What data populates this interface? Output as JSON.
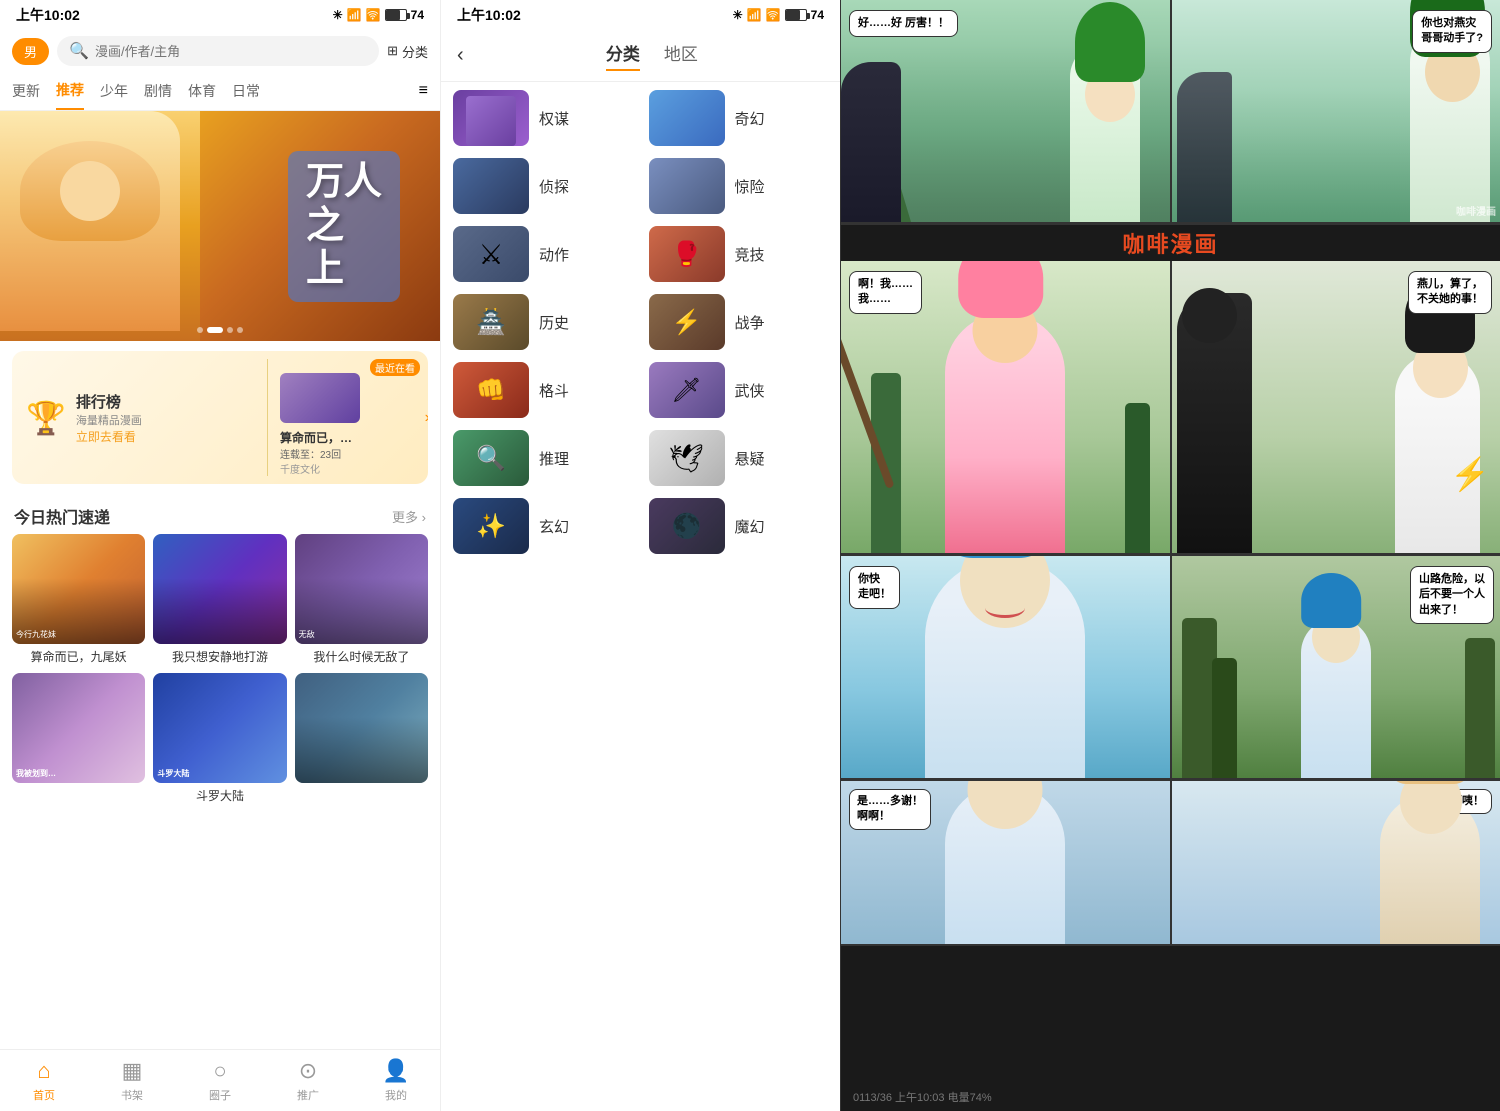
{
  "home": {
    "status_time": "上午10:02",
    "gender_btn": "男",
    "search_placeholder": "漫画/作者/主角",
    "category_btn": "分类",
    "nav_tabs": [
      "更新",
      "推荐",
      "少年",
      "剧情",
      "体育",
      "日常"
    ],
    "active_tab": "推荐",
    "banner_title": "万人\n之\n上",
    "ranking_title": "排行榜",
    "ranking_sub": "海量精品漫画",
    "ranking_link": "立即去看看",
    "recent_label": "最近在看",
    "recent_manga": "算命而已，…",
    "recent_chapter": "连载至：23回",
    "recent_publisher": "千度文化",
    "section_title": "今日热门速递",
    "more_btn": "更多 ›",
    "manga_list": [
      {
        "title": "算命而已，九尾妖"
      },
      {
        "title": "我只想安静地打游"
      },
      {
        "title": "我什么时候无敌了"
      }
    ],
    "manga_list2": [
      {
        "title": ""
      },
      {
        "title": "斗罗大陆"
      },
      {
        "title": ""
      }
    ],
    "bottom_nav": [
      {
        "label": "首页",
        "icon": "⌂",
        "active": true
      },
      {
        "label": "书架",
        "icon": "▦"
      },
      {
        "label": "圈子",
        "icon": "○"
      },
      {
        "label": "推广",
        "icon": "⊙"
      },
      {
        "label": "我的",
        "icon": "👤"
      }
    ]
  },
  "category": {
    "status_time": "上午10:02",
    "back_icon": "‹",
    "tabs": [
      {
        "label": "分类",
        "active": true
      },
      {
        "label": "地区",
        "active": false
      }
    ],
    "items": [
      {
        "label": "权谋",
        "color": "ct-purple"
      },
      {
        "label": "奇幻",
        "color": "ct-blue"
      },
      {
        "label": "侦探",
        "color": "ct-dark"
      },
      {
        "label": "惊险",
        "color": "ct-action"
      },
      {
        "label": "动作",
        "color": "ct-action"
      },
      {
        "label": "竞技",
        "color": "ct-fight"
      },
      {
        "label": "历史",
        "color": "ct-hist"
      },
      {
        "label": "战争",
        "color": "ct-war"
      },
      {
        "label": "格斗",
        "color": "ct-fight"
      },
      {
        "label": "武侠",
        "color": "ct-purple"
      },
      {
        "label": "推理",
        "color": "ct-reason"
      },
      {
        "label": "悬疑",
        "color": "ct-mystery"
      },
      {
        "label": "玄幻",
        "color": "ct-fantasy"
      },
      {
        "label": "魔幻",
        "color": "ct-magic"
      }
    ]
  },
  "reader": {
    "bubble1_top": "好……好\n厉害！！",
    "bubble1_right": "你也对燕灾\n哥哥动手了?",
    "bubble2_left": "啊！我……\n我……",
    "bubble2_right": "燕儿，算了，\n不关她的事！",
    "bubble3_left": "你快\n走吧！",
    "bubble3_right": "山路危险，以\n后不要一个人\n出来了！",
    "bubble4_left": "是……多谢！\n啊啊！",
    "bubble4_right": "啊咦！",
    "status_bottom": "0113/36  上午10:03  电量74%"
  }
}
